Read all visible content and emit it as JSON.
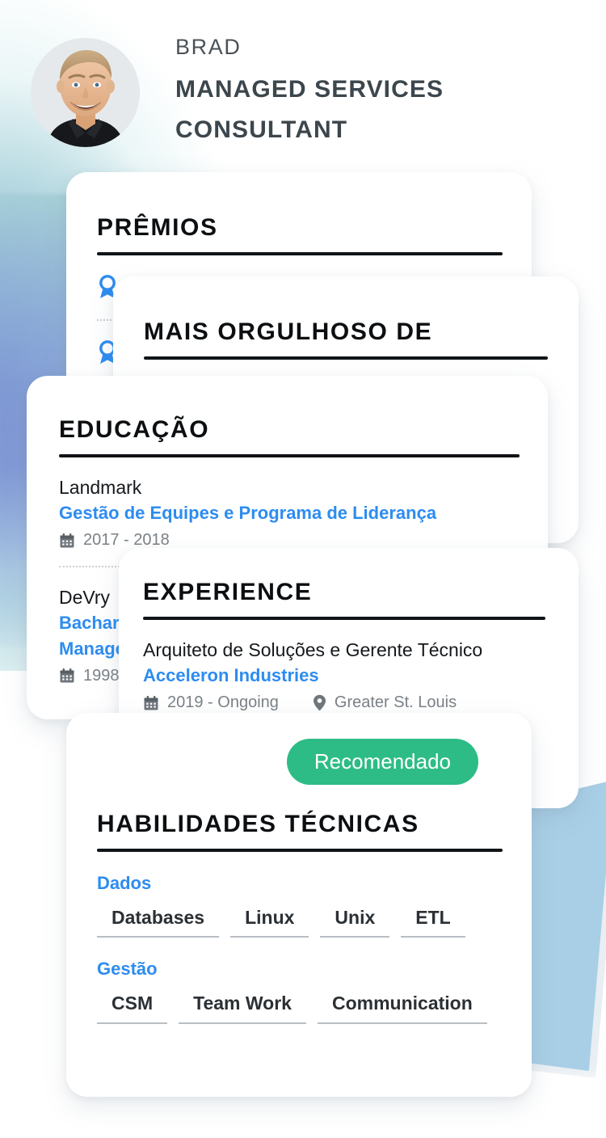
{
  "header": {
    "kicker": "BRAD",
    "title_line1": "MANAGED SERVICES",
    "title_line2": "CONSULTANT",
    "avatar_alt": "avatar"
  },
  "colors": {
    "accent_blue": "#2d8cf0",
    "accent_green": "#2dbc85",
    "text_dark": "#15191c",
    "muted": "#7a8186",
    "wedge_blue": "#a8cfe6"
  },
  "cards": {
    "awards": {
      "title": "PRÊMIOS",
      "items": [
        {
          "icon": "award-ribbon-icon",
          "name": "",
          "sub": ""
        },
        {
          "icon": "award-ribbon-icon",
          "name": "",
          "sub": ""
        }
      ]
    },
    "proudest": {
      "title": "MAIS ORGULHOSO DE",
      "body": ""
    },
    "education": {
      "title": "EDUCAÇÃO",
      "entries": [
        {
          "org": "Landmark",
          "program": "Gestão de Equipes e Programa de Liderança",
          "date_icon": "calendar-icon",
          "dates": "2017 - 2018"
        },
        {
          "org": "DeVry",
          "program_line1": "Bacharelado",
          "program_line2": "Management",
          "date_icon": "calendar-icon",
          "dates": "1998"
        }
      ]
    },
    "experience": {
      "title": "EXPERIENCE",
      "role": "Arquiteto de Soluções e Gerente Técnico",
      "company": "Acceleron Industries",
      "date_icon": "calendar-icon",
      "dates": "2019 - Ongoing",
      "location_icon": "map-pin-icon",
      "location": "Greater St. Louis",
      "description": ""
    },
    "skills": {
      "badge": "Recomendado",
      "title": "HABILIDADES TÉCNICAS",
      "groups": [
        {
          "name": "Dados",
          "chips": [
            "Databases",
            "Linux",
            "Unix",
            "ETL"
          ]
        },
        {
          "name": "Gestão",
          "chips": [
            "CSM",
            "Team Work",
            "Communication"
          ]
        }
      ]
    }
  }
}
